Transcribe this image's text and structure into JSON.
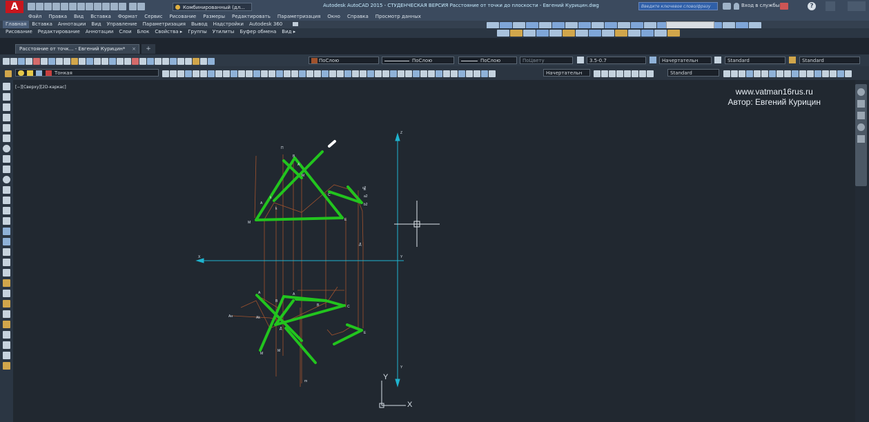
{
  "titlebar": {
    "workspace": "Комбинированный (дл...",
    "title": "Autodesk AutoCAD 2015 - СТУДЕНЧЕСКАЯ ВЕРСИЯ   Расстояние от точки до плоскости - Евгений Курицин.dwg",
    "search_placeholder": "Введите ключевое слово/фразу",
    "signin": "Вход в службы"
  },
  "menu": [
    "Файл",
    "Правка",
    "Вид",
    "Вставка",
    "Формат",
    "Сервис",
    "Рисование",
    "Размеры",
    "Редактировать",
    "Параметризация",
    "Окно",
    "Справка",
    "Просмотр данных"
  ],
  "ribbon_tabs": [
    "Главная",
    "Вставка",
    "Аннотации",
    "Вид",
    "Управление",
    "Параметризация",
    "Вывод",
    "Надстройки",
    "Autodesk 360"
  ],
  "ribbon_panels": [
    "Рисование",
    "Редактирование",
    "Аннотации",
    "Слои",
    "Блок",
    "Свойства ▸",
    "Группы",
    "Утилиты",
    "Буфер обмена",
    "Вид ▸"
  ],
  "doc_tab": "Расстояние от точк... - Евгений Курицин*",
  "properties": {
    "color": "ПоСлою",
    "linetype": "ПоСлою",
    "lineweight": "ПоСлою",
    "plotstyle": "ПоЦвету",
    "text_height": "3.5-0.7",
    "dim_style": "Начертательн",
    "text_style": "Standard",
    "table_style": "Standard"
  },
  "layer": {
    "current": "Тонкая",
    "dim_style": "Начертательн",
    "mleader_style": "Standard"
  },
  "viewport_label": "[−][Сверху][2D-каркас]",
  "watermark": {
    "line1": "www.vatman16rus.ru",
    "line2": "Автор: Евгений Курицин"
  },
  "ucs": {
    "x": "X",
    "y": "Y"
  },
  "colors": {
    "accent": "#c8161d",
    "green": "#22c41e",
    "cyan": "#1fb4cf",
    "projection": "#a0522d",
    "background": "#212830"
  },
  "drawing": {
    "upper": [
      "П",
      "В",
      "А",
      "А",
      "С",
      "k",
      "k",
      "M",
      "M",
      "E",
      "Д",
      "Е",
      "c2",
      "a2",
      "b2"
    ],
    "lower": [
      "А",
      "А",
      "В",
      "В",
      "С",
      "Е",
      "Д",
      "Ан",
      "Ak",
      "M",
      "M",
      "m"
    ],
    "axis": [
      "X",
      "Y",
      "Z",
      "Y"
    ]
  }
}
